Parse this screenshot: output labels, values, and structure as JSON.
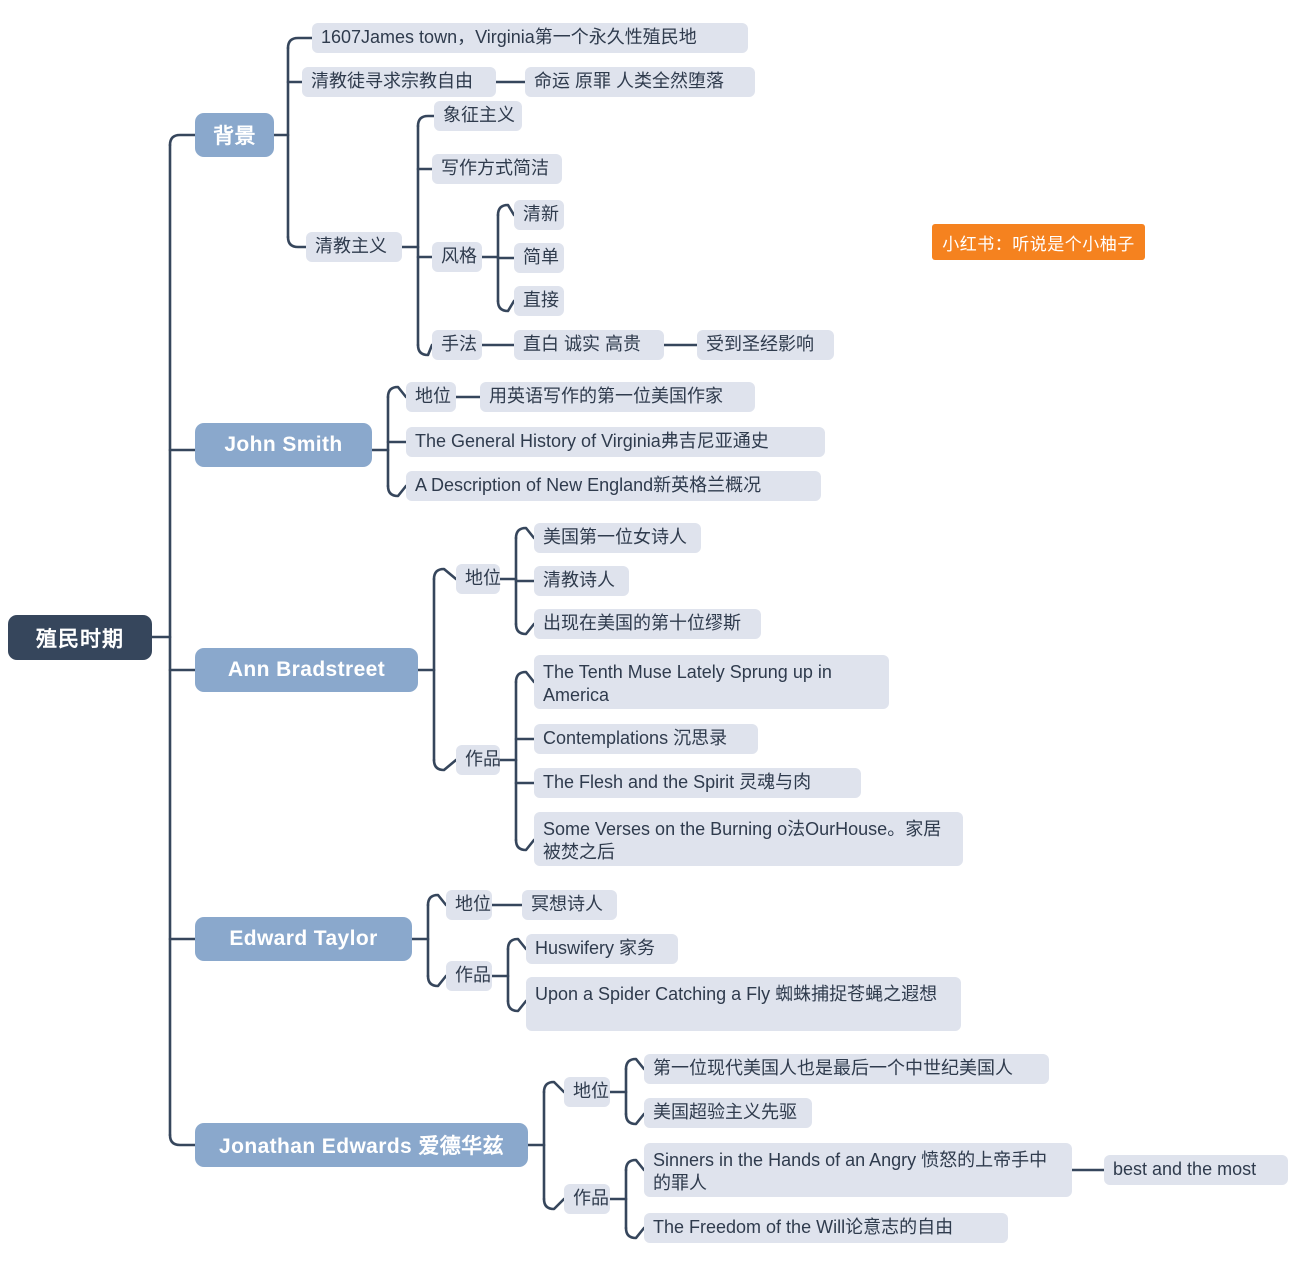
{
  "diagram": {
    "title": "殖民时期",
    "type": "mindmap",
    "colors": {
      "root_bg": "#36465c",
      "level1_bg": "#8aa8cc",
      "pill_bg": "#dfe3ed",
      "pill_text": "#2f3b4d",
      "connector": "#36465c",
      "badge_bg": "#f5821f",
      "canvas_bg": "#ffffff"
    }
  },
  "root": {
    "label": "殖民时期"
  },
  "watermark": {
    "label": "小红书：听说是个小柚子"
  },
  "branches": [
    {
      "id": "background",
      "label": "背景",
      "children": [
        {
          "label": "1607James town，Virginia第一个永久性殖民地"
        },
        {
          "label": "清教徒寻求宗教自由",
          "tail": "命运 原罪 人类全然堕落"
        },
        {
          "label": "清教主义",
          "children": [
            {
              "label": "象征主义"
            },
            {
              "label": "写作方式简洁"
            },
            {
              "label": "风格",
              "children": [
                {
                  "label": "清新"
                },
                {
                  "label": "简单"
                },
                {
                  "label": "直接"
                }
              ]
            },
            {
              "label": "手法",
              "mid": "直白 诚实 高贵",
              "tail": "受到圣经影响"
            }
          ]
        }
      ]
    },
    {
      "id": "john-smith",
      "label": "John Smith",
      "children": [
        {
          "label": "地位",
          "tail": "用英语写作的第一位美国作家"
        },
        {
          "label": "The General History of Virginia弗吉尼亚通史"
        },
        {
          "label": "A Description of New England新英格兰概况"
        }
      ]
    },
    {
      "id": "ann-bradstreet",
      "label": "Ann Bradstreet",
      "groups": [
        {
          "label": "地位",
          "items": [
            {
              "label": "美国第一位女诗人"
            },
            {
              "label": "清教诗人"
            },
            {
              "label": "出现在美国的第十位缪斯"
            }
          ]
        },
        {
          "label": "作品",
          "items": [
            {
              "label": "The Tenth Muse Lately Sprung up in America"
            },
            {
              "label": "Contemplations 沉思录"
            },
            {
              "label": "The Flesh and the Spirit 灵魂与肉"
            },
            {
              "label": "Some Verses on the Burning o法OurHouse。家居被焚之后"
            }
          ]
        }
      ]
    },
    {
      "id": "edward-taylor",
      "label": "Edward Taylor",
      "groups": [
        {
          "label": "地位",
          "items": [
            {
              "label": "冥想诗人"
            }
          ]
        },
        {
          "label": "作品",
          "items": [
            {
              "label": "Huswifery 家务"
            },
            {
              "label": "Upon a Spider Catching a Fly 蜘蛛捕捉苍蝇之遐想"
            }
          ]
        }
      ]
    },
    {
      "id": "jonathan-edwards",
      "label": "Jonathan Edwards 爱德华兹",
      "groups": [
        {
          "label": "地位",
          "items": [
            {
              "label": "第一位现代美国人也是最后一个中世纪美国人"
            },
            {
              "label": "美国超验主义先驱"
            }
          ]
        },
        {
          "label": "作品",
          "items": [
            {
              "label": "Sinners in the Hands of an Angry 愤怒的上帝手中的罪人",
              "tail": "best and the most"
            },
            {
              "label": "The Freedom of the Will论意志的自由"
            }
          ]
        }
      ]
    }
  ]
}
